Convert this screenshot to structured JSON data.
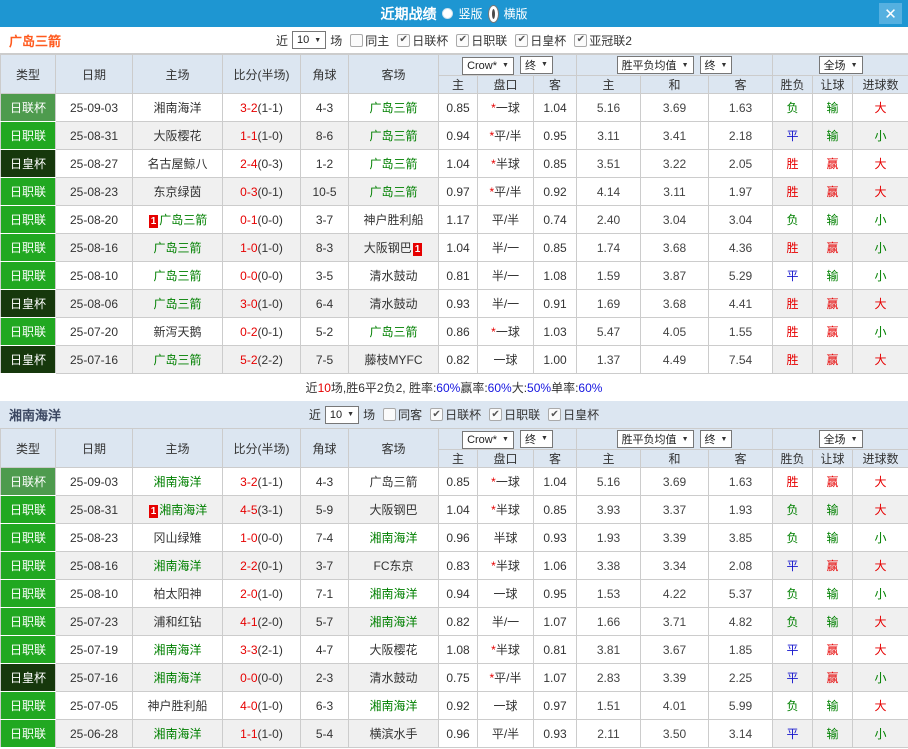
{
  "window": {
    "title": "近期战绩",
    "radio_vertical": "竖版",
    "radio_horizontal": "横版",
    "radio_selected": "横版",
    "close_label": "✕"
  },
  "colors": {
    "topbar": "#1e96d2",
    "close_btn": "#55b0e0",
    "team_accent": "#ff5a1e",
    "team_dark": "#3a4660",
    "league_cup_bg": "#4e9b4e",
    "league_j1_bg": "#21a821",
    "league_emperor_bg": "#16380c",
    "ah_col_bg": "#fbf3e8",
    "eu_col_bg": "#eaf3fa",
    "header_bg": "#dce6f1",
    "teambar_bg": "#dce6f1",
    "row_alt_bg": "#f0f0f0",
    "win_red": "#e60000",
    "lose_green": "#008000",
    "draw_blue": "#1414cc"
  },
  "filter_labels": {
    "near": "近",
    "games": "场"
  },
  "columns": {
    "left": [
      "类型",
      "日期",
      "主场",
      "比分(半场)",
      "角球",
      "客场"
    ],
    "group_selects": [
      "Crow*",
      "终",
      "胜平负均值",
      "终",
      "全场"
    ],
    "sub": [
      "主",
      "盘口",
      "客",
      "主",
      "和",
      "客",
      "胜负",
      "让球",
      "进球数"
    ]
  },
  "sections": [
    {
      "team": "广岛三箭",
      "team_style": "orange",
      "filter": {
        "count": "10",
        "same_label": "同主",
        "same_checked": false,
        "leagues": [
          {
            "label": "日联杯",
            "checked": true
          },
          {
            "label": "日职联",
            "checked": true
          },
          {
            "label": "日皇杯",
            "checked": true
          },
          {
            "label": "亚冠联2",
            "checked": true
          }
        ]
      },
      "rows": [
        {
          "league": "日联杯",
          "date": "25-09-03",
          "home": "湘南海洋",
          "home_is_focus": false,
          "home_badge": null,
          "score": "3-2",
          "half": "(1-1)",
          "corners": "4-3",
          "away": "广岛三箭",
          "away_is_focus": true,
          "away_badge": null,
          "ah_home": "0.85",
          "ah_star": true,
          "ah_line": "一球",
          "ah_away": "1.04",
          "eu_home": "5.16",
          "eu_draw": "3.69",
          "eu_away": "1.63",
          "result_wdl": "负",
          "result_handicap": "输",
          "result_ou": "大"
        },
        {
          "league": "日职联",
          "date": "25-08-31",
          "home": "大阪樱花",
          "home_is_focus": false,
          "home_badge": null,
          "score": "1-1",
          "half": "(1-0)",
          "corners": "8-6",
          "away": "广岛三箭",
          "away_is_focus": true,
          "away_badge": null,
          "ah_home": "0.94",
          "ah_star": true,
          "ah_line": "平/半",
          "ah_away": "0.95",
          "eu_home": "3.11",
          "eu_draw": "3.41",
          "eu_away": "2.18",
          "result_wdl": "平",
          "result_handicap": "输",
          "result_ou": "小"
        },
        {
          "league": "日皇杯",
          "date": "25-08-27",
          "home": "名古屋鲸八",
          "home_is_focus": false,
          "home_badge": null,
          "score": "2-4",
          "half": "(0-3)",
          "corners": "1-2",
          "away": "广岛三箭",
          "away_is_focus": true,
          "away_badge": null,
          "ah_home": "1.04",
          "ah_star": true,
          "ah_line": "半球",
          "ah_away": "0.85",
          "eu_home": "3.51",
          "eu_draw": "3.22",
          "eu_away": "2.05",
          "result_wdl": "胜",
          "result_handicap": "赢",
          "result_ou": "大"
        },
        {
          "league": "日职联",
          "date": "25-08-23",
          "home": "东京绿茵",
          "home_is_focus": false,
          "home_badge": null,
          "score": "0-3",
          "half": "(0-1)",
          "corners": "10-5",
          "away": "广岛三箭",
          "away_is_focus": true,
          "away_badge": null,
          "ah_home": "0.97",
          "ah_star": true,
          "ah_line": "平/半",
          "ah_away": "0.92",
          "eu_home": "4.14",
          "eu_draw": "3.11",
          "eu_away": "1.97",
          "result_wdl": "胜",
          "result_handicap": "赢",
          "result_ou": "大"
        },
        {
          "league": "日职联",
          "date": "25-08-20",
          "home": "广岛三箭",
          "home_is_focus": true,
          "home_badge": "1",
          "score": "0-1",
          "half": "(0-0)",
          "corners": "3-7",
          "away": "神户胜利船",
          "away_is_focus": false,
          "away_badge": null,
          "ah_home": "1.17",
          "ah_star": false,
          "ah_line": "平/半",
          "ah_away": "0.74",
          "eu_home": "2.40",
          "eu_draw": "3.04",
          "eu_away": "3.04",
          "result_wdl": "负",
          "result_handicap": "输",
          "result_ou": "小"
        },
        {
          "league": "日职联",
          "date": "25-08-16",
          "home": "广岛三箭",
          "home_is_focus": true,
          "home_badge": null,
          "score": "1-0",
          "half": "(1-0)",
          "corners": "8-3",
          "away": "大阪钢巴",
          "away_is_focus": false,
          "away_badge": "1",
          "ah_home": "1.04",
          "ah_star": false,
          "ah_line": "半/一",
          "ah_away": "0.85",
          "eu_home": "1.74",
          "eu_draw": "3.68",
          "eu_away": "4.36",
          "result_wdl": "胜",
          "result_handicap": "赢",
          "result_ou": "小"
        },
        {
          "league": "日职联",
          "date": "25-08-10",
          "home": "广岛三箭",
          "home_is_focus": true,
          "home_badge": null,
          "score": "0-0",
          "half": "(0-0)",
          "corners": "3-5",
          "away": "清水鼓动",
          "away_is_focus": false,
          "away_badge": null,
          "ah_home": "0.81",
          "ah_star": false,
          "ah_line": "半/一",
          "ah_away": "1.08",
          "eu_home": "1.59",
          "eu_draw": "3.87",
          "eu_away": "5.29",
          "result_wdl": "平",
          "result_handicap": "输",
          "result_ou": "小"
        },
        {
          "league": "日皇杯",
          "date": "25-08-06",
          "home": "广岛三箭",
          "home_is_focus": true,
          "home_badge": null,
          "score": "3-0",
          "half": "(1-0)",
          "corners": "6-4",
          "away": "清水鼓动",
          "away_is_focus": false,
          "away_badge": null,
          "ah_home": "0.93",
          "ah_star": false,
          "ah_line": "半/一",
          "ah_away": "0.91",
          "eu_home": "1.69",
          "eu_draw": "3.68",
          "eu_away": "4.41",
          "result_wdl": "胜",
          "result_handicap": "赢",
          "result_ou": "大"
        },
        {
          "league": "日职联",
          "date": "25-07-20",
          "home": "新泻天鹅",
          "home_is_focus": false,
          "home_badge": null,
          "score": "0-2",
          "half": "(0-1)",
          "corners": "5-2",
          "away": "广岛三箭",
          "away_is_focus": true,
          "away_badge": null,
          "ah_home": "0.86",
          "ah_star": true,
          "ah_line": "一球",
          "ah_away": "1.03",
          "eu_home": "5.47",
          "eu_draw": "4.05",
          "eu_away": "1.55",
          "result_wdl": "胜",
          "result_handicap": "赢",
          "result_ou": "小"
        },
        {
          "league": "日皇杯",
          "date": "25-07-16",
          "home": "广岛三箭",
          "home_is_focus": true,
          "home_badge": null,
          "score": "5-2",
          "half": "(2-2)",
          "corners": "7-5",
          "away": "藤枝MYFC",
          "away_is_focus": false,
          "away_badge": null,
          "ah_home": "0.82",
          "ah_star": false,
          "ah_line": "一球",
          "ah_away": "1.00",
          "eu_home": "1.37",
          "eu_draw": "4.49",
          "eu_away": "7.54",
          "result_wdl": "胜",
          "result_handicap": "赢",
          "result_ou": "大"
        }
      ],
      "summary": {
        "segments": [
          {
            "t": "近",
            "c": "dark"
          },
          {
            "t": "10",
            "c": "red"
          },
          {
            "t": "场,胜6平2负2, 胜率:",
            "c": "dark"
          },
          {
            "t": "60%",
            "c": "blue"
          },
          {
            "t": " 赢率:",
            "c": "dark"
          },
          {
            "t": "60%",
            "c": "blue"
          },
          {
            "t": " 大:",
            "c": "dark"
          },
          {
            "t": "50%",
            "c": "blue"
          },
          {
            "t": " 单率:",
            "c": "dark"
          },
          {
            "t": "60%",
            "c": "blue"
          }
        ]
      }
    },
    {
      "team": "湘南海洋",
      "team_style": "dark",
      "filter": {
        "count": "10",
        "same_label": "同客",
        "same_checked": false,
        "leagues": [
          {
            "label": "日联杯",
            "checked": true
          },
          {
            "label": "日职联",
            "checked": true
          },
          {
            "label": "日皇杯",
            "checked": true
          }
        ]
      },
      "rows": [
        {
          "league": "日联杯",
          "date": "25-09-03",
          "home": "湘南海洋",
          "home_is_focus": true,
          "home_badge": null,
          "score": "3-2",
          "half": "(1-1)",
          "corners": "4-3",
          "away": "广岛三箭",
          "away_is_focus": false,
          "away_badge": null,
          "ah_home": "0.85",
          "ah_star": true,
          "ah_line": "一球",
          "ah_away": "1.04",
          "eu_home": "5.16",
          "eu_draw": "3.69",
          "eu_away": "1.63",
          "result_wdl": "胜",
          "result_handicap": "赢",
          "result_ou": "大"
        },
        {
          "league": "日职联",
          "date": "25-08-31",
          "home": "湘南海洋",
          "home_is_focus": true,
          "home_badge": "1",
          "score": "4-5",
          "half": "(3-1)",
          "corners": "5-9",
          "away": "大阪钢巴",
          "away_is_focus": false,
          "away_badge": null,
          "ah_home": "1.04",
          "ah_star": true,
          "ah_line": "半球",
          "ah_away": "0.85",
          "eu_home": "3.93",
          "eu_draw": "3.37",
          "eu_away": "1.93",
          "result_wdl": "负",
          "result_handicap": "输",
          "result_ou": "大"
        },
        {
          "league": "日职联",
          "date": "25-08-23",
          "home": "冈山绿雉",
          "home_is_focus": false,
          "home_badge": null,
          "score": "1-0",
          "half": "(0-0)",
          "corners": "7-4",
          "away": "湘南海洋",
          "away_is_focus": true,
          "away_badge": null,
          "ah_home": "0.96",
          "ah_star": false,
          "ah_line": "半球",
          "ah_away": "0.93",
          "eu_home": "1.93",
          "eu_draw": "3.39",
          "eu_away": "3.85",
          "result_wdl": "负",
          "result_handicap": "输",
          "result_ou": "小"
        },
        {
          "league": "日职联",
          "date": "25-08-16",
          "home": "湘南海洋",
          "home_is_focus": true,
          "home_badge": null,
          "score": "2-2",
          "half": "(0-1)",
          "corners": "3-7",
          "away": "FC东京",
          "away_is_focus": false,
          "away_badge": null,
          "ah_home": "0.83",
          "ah_star": true,
          "ah_line": "半球",
          "ah_away": "1.06",
          "eu_home": "3.38",
          "eu_draw": "3.34",
          "eu_away": "2.08",
          "result_wdl": "平",
          "result_handicap": "赢",
          "result_ou": "大"
        },
        {
          "league": "日职联",
          "date": "25-08-10",
          "home": "柏太阳神",
          "home_is_focus": false,
          "home_badge": null,
          "score": "2-0",
          "half": "(1-0)",
          "corners": "7-1",
          "away": "湘南海洋",
          "away_is_focus": true,
          "away_badge": null,
          "ah_home": "0.94",
          "ah_star": false,
          "ah_line": "一球",
          "ah_away": "0.95",
          "eu_home": "1.53",
          "eu_draw": "4.22",
          "eu_away": "5.37",
          "result_wdl": "负",
          "result_handicap": "输",
          "result_ou": "小"
        },
        {
          "league": "日职联",
          "date": "25-07-23",
          "home": "浦和红钻",
          "home_is_focus": false,
          "home_badge": null,
          "score": "4-1",
          "half": "(2-0)",
          "corners": "5-7",
          "away": "湘南海洋",
          "away_is_focus": true,
          "away_badge": null,
          "ah_home": "0.82",
          "ah_star": false,
          "ah_line": "半/一",
          "ah_away": "1.07",
          "eu_home": "1.66",
          "eu_draw": "3.71",
          "eu_away": "4.82",
          "result_wdl": "负",
          "result_handicap": "输",
          "result_ou": "大"
        },
        {
          "league": "日职联",
          "date": "25-07-19",
          "home": "湘南海洋",
          "home_is_focus": true,
          "home_badge": null,
          "score": "3-3",
          "half": "(2-1)",
          "corners": "4-7",
          "away": "大阪樱花",
          "away_is_focus": false,
          "away_badge": null,
          "ah_home": "1.08",
          "ah_star": true,
          "ah_line": "半球",
          "ah_away": "0.81",
          "eu_home": "3.81",
          "eu_draw": "3.67",
          "eu_away": "1.85",
          "result_wdl": "平",
          "result_handicap": "赢",
          "result_ou": "大"
        },
        {
          "league": "日皇杯",
          "date": "25-07-16",
          "home": "湘南海洋",
          "home_is_focus": true,
          "home_badge": null,
          "score": "0-0",
          "half": "(0-0)",
          "corners": "2-3",
          "away": "清水鼓动",
          "away_is_focus": false,
          "away_badge": null,
          "ah_home": "0.75",
          "ah_star": true,
          "ah_line": "平/半",
          "ah_away": "1.07",
          "eu_home": "2.83",
          "eu_draw": "3.39",
          "eu_away": "2.25",
          "result_wdl": "平",
          "result_handicap": "赢",
          "result_ou": "小"
        },
        {
          "league": "日职联",
          "date": "25-07-05",
          "home": "神户胜利船",
          "home_is_focus": false,
          "home_badge": null,
          "score": "4-0",
          "half": "(1-0)",
          "corners": "6-3",
          "away": "湘南海洋",
          "away_is_focus": true,
          "away_badge": null,
          "ah_home": "0.92",
          "ah_star": false,
          "ah_line": "一球",
          "ah_away": "0.97",
          "eu_home": "1.51",
          "eu_draw": "4.01",
          "eu_away": "5.99",
          "result_wdl": "负",
          "result_handicap": "输",
          "result_ou": "大"
        },
        {
          "league": "日职联",
          "date": "25-06-28",
          "home": "湘南海洋",
          "home_is_focus": true,
          "home_badge": null,
          "score": "1-1",
          "half": "(1-0)",
          "corners": "5-4",
          "away": "横滨水手",
          "away_is_focus": false,
          "away_badge": null,
          "ah_home": "0.96",
          "ah_star": false,
          "ah_line": "平/半",
          "ah_away": "0.93",
          "eu_home": "2.11",
          "eu_draw": "3.50",
          "eu_away": "3.14",
          "result_wdl": "平",
          "result_handicap": "输",
          "result_ou": "小"
        }
      ]
    }
  ]
}
